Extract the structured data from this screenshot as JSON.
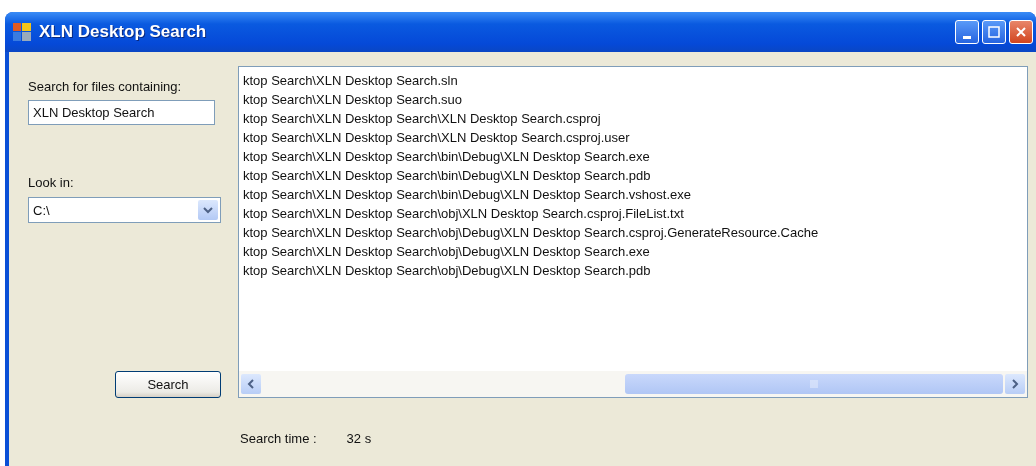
{
  "window": {
    "title": "XLN Desktop Search"
  },
  "search_label": "Search for files containing:",
  "search_field": {
    "value": "XLN Desktop Search"
  },
  "look_in_label": "Look in:",
  "look_in": {
    "value": "C:\\"
  },
  "search_button": "Search",
  "results": [
    "ktop Search\\XLN Desktop Search.sln",
    "ktop Search\\XLN Desktop Search.suo",
    "ktop Search\\XLN Desktop Search\\XLN Desktop Search.csproj",
    "ktop Search\\XLN Desktop Search\\XLN Desktop Search.csproj.user",
    "ktop Search\\XLN Desktop Search\\bin\\Debug\\XLN Desktop Search.exe",
    "ktop Search\\XLN Desktop Search\\bin\\Debug\\XLN Desktop Search.pdb",
    "ktop Search\\XLN Desktop Search\\bin\\Debug\\XLN Desktop Search.vshost.exe",
    "ktop Search\\XLN Desktop Search\\obj\\XLN Desktop Search.csproj.FileList.txt",
    "ktop Search\\XLN Desktop Search\\obj\\Debug\\XLN Desktop Search.csproj.GenerateResource.Cache",
    "ktop Search\\XLN Desktop Search\\obj\\Debug\\XLN Desktop Search.exe",
    "ktop Search\\XLN Desktop Search\\obj\\Debug\\XLN Desktop Search.pdb"
  ],
  "status": {
    "label": "Search time :",
    "value": "32 s"
  }
}
